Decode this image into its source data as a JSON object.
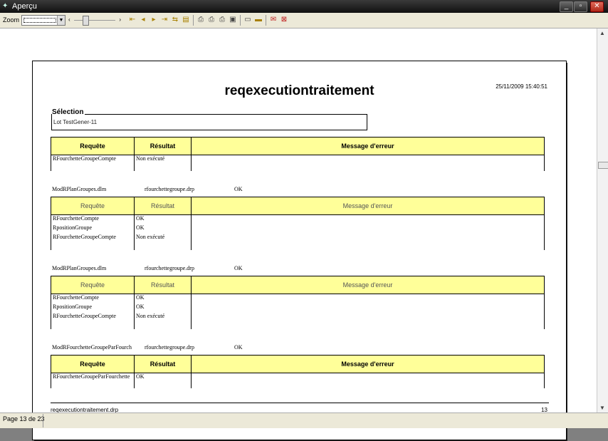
{
  "window": {
    "title": "Aperçu",
    "app_icon": "preview-app-icon",
    "controls": {
      "minimize": "_",
      "maximize": "▫",
      "close": "✕"
    }
  },
  "toolbar": {
    "zoom_label": "Zoom",
    "zoom_value": "",
    "slider_left": "‹",
    "slider_right": "›",
    "buttons": [
      "first-page-icon",
      "prev-page-icon",
      "next-page-icon",
      "last-page-icon",
      "goto-page-icon",
      "page-setup-icon",
      "print-icon",
      "print-setup-icon",
      "print-all-icon",
      "pdf-icon",
      "export-icon",
      "save-icon",
      "mail-icon",
      "close-preview-icon"
    ]
  },
  "report": {
    "title": "reqexecutiontraitement",
    "datetime": "25/11/2009 15:40:51",
    "selection_label": "Sélection",
    "selection_value": "Lot     TestGener-11",
    "headers": {
      "request": "Requête",
      "result": "Résultat",
      "error": "Message d'erreur"
    },
    "sections": [
      {
        "info": {
          "name": "",
          "file": "",
          "status": ""
        },
        "rows": [
          {
            "request": "RFourchetteGroupeCompte",
            "result": "Non exécuté",
            "error": ""
          }
        ]
      },
      {
        "info": {
          "name": "ModRPlanGroupes.dlm",
          "file": "rfourchettegroupe.drp",
          "status": "OK"
        },
        "rows": [
          {
            "request": "RFourchetteCompte",
            "result": "OK",
            "error": ""
          },
          {
            "request": "RpositionGroupe",
            "result": "OK",
            "error": ""
          },
          {
            "request": "RFourchetteGroupeCompte",
            "result": "Non exécuté",
            "error": ""
          }
        ]
      },
      {
        "info": {
          "name": "ModRPlanGroupes.dlm",
          "file": "rfourchettegroupe.drp",
          "status": "OK"
        },
        "rows": [
          {
            "request": "RFourchetteCompte",
            "result": "OK",
            "error": ""
          },
          {
            "request": "RpositionGroupe",
            "result": "OK",
            "error": ""
          },
          {
            "request": "RFourchetteGroupeCompte",
            "result": "Non exécuté",
            "error": ""
          }
        ]
      },
      {
        "info": {
          "name": "ModRFourchetteGroupeParFourch",
          "file": "rfourchettegroupe.drp",
          "status": "OK"
        },
        "rows": [
          {
            "request": "RFourchetteGroupeParFourchette",
            "result": "OK",
            "error": ""
          }
        ]
      }
    ],
    "footer_file": "reqexecutiontraitement.drp",
    "footer_page": "13"
  },
  "status_bar": {
    "text": "Page 13 de 23"
  }
}
